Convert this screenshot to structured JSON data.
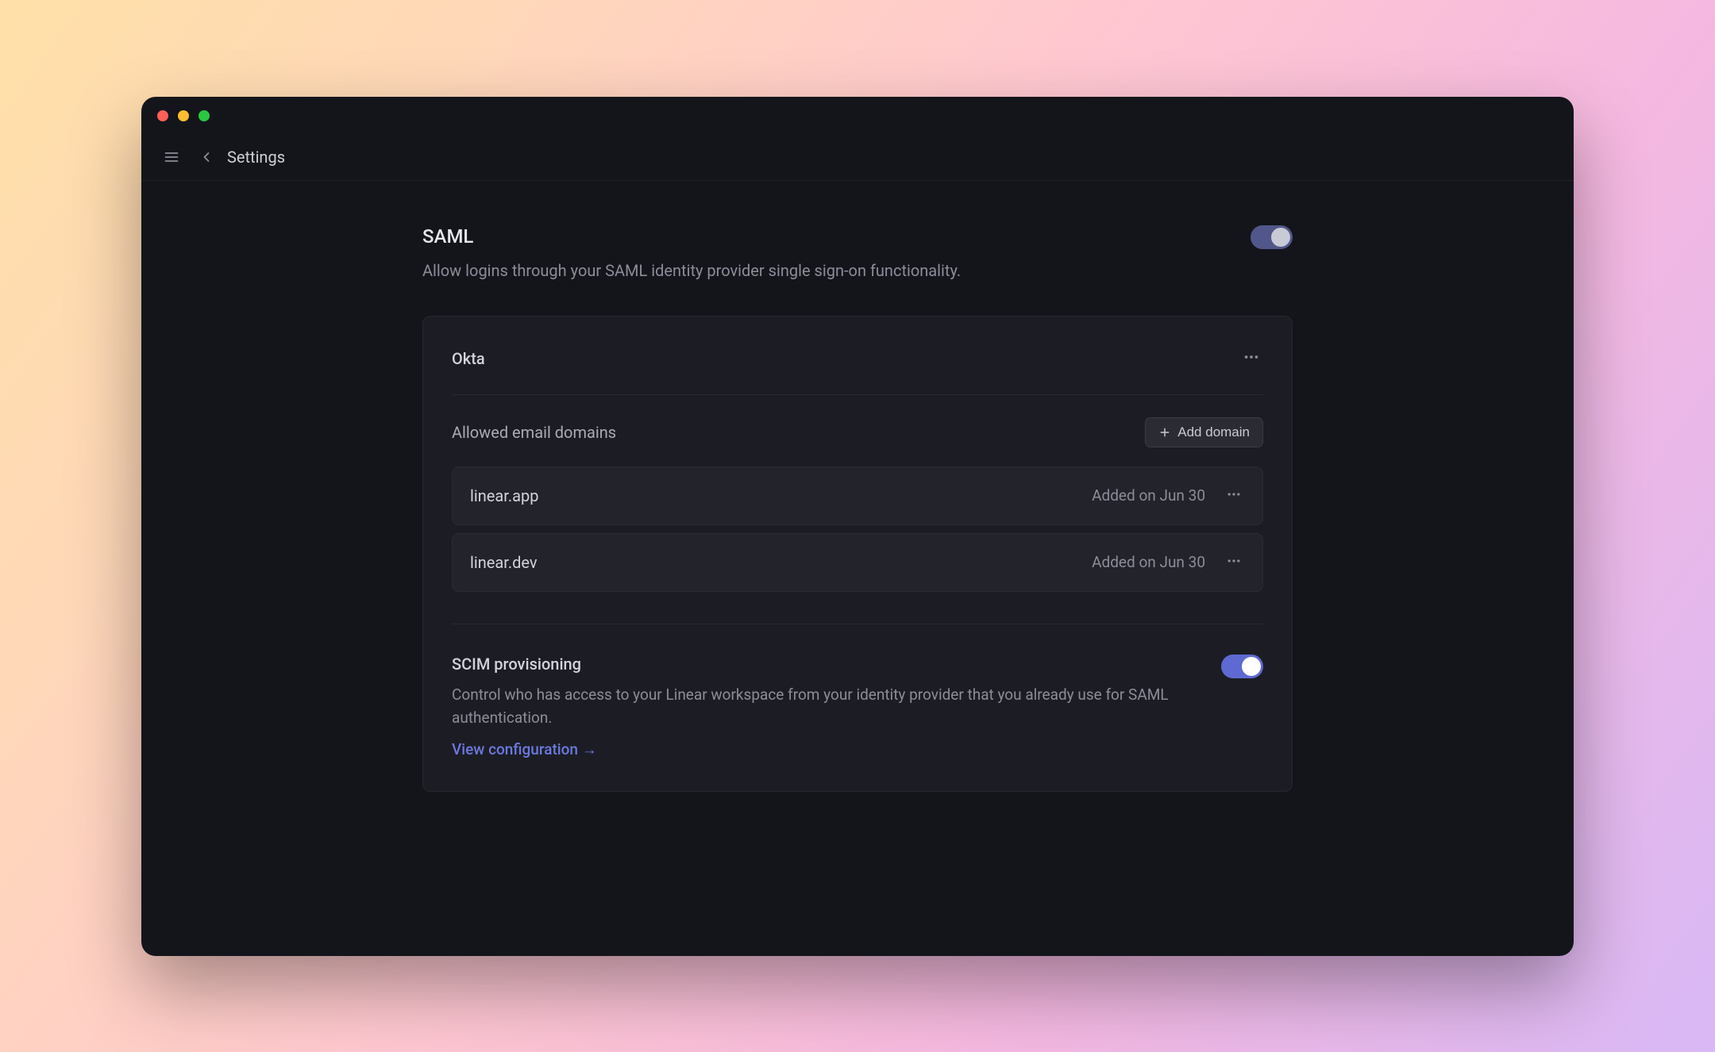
{
  "header": {
    "title": "Settings"
  },
  "saml": {
    "title": "SAML",
    "description": "Allow logins through your SAML identity provider single sign-on functionality.",
    "enabled": true,
    "provider": {
      "name": "Okta"
    },
    "domains": {
      "label": "Allowed email domains",
      "add_button_label": "Add domain",
      "list": [
        {
          "domain": "linear.app",
          "added_label": "Added on Jun 30"
        },
        {
          "domain": "linear.dev",
          "added_label": "Added on Jun 30"
        }
      ]
    }
  },
  "scim": {
    "title": "SCIM provisioning",
    "description": "Control who has access to your Linear workspace from your identity provider that you already use for SAML authentication.",
    "link_label": "View configuration →",
    "enabled": true
  }
}
